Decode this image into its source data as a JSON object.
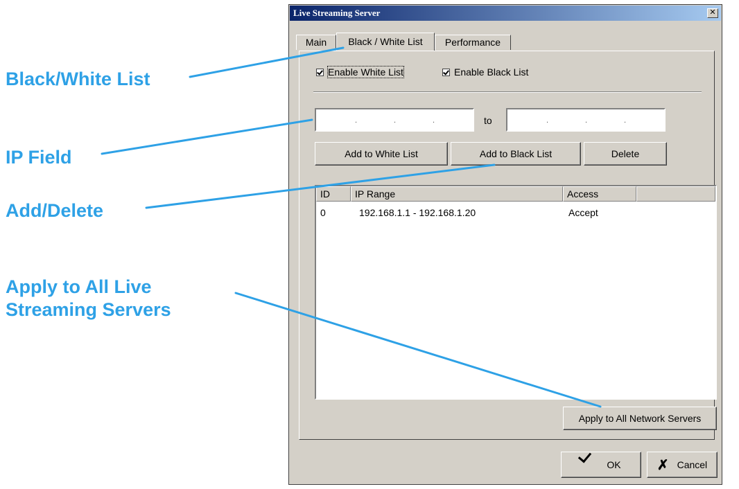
{
  "callouts": {
    "black_white_list": "Black/White List",
    "ip_field": "IP Field",
    "add_delete": "Add/Delete",
    "apply_line1": "Apply to All Live",
    "apply_line2": "Streaming Servers",
    "color": "#2ea1e6"
  },
  "dialog": {
    "title": "Live Streaming Server",
    "close_glyph": "✕",
    "tabs": [
      "Main",
      "Black / White List",
      "Performance"
    ],
    "active_tab": "Black / White List"
  },
  "lists": {
    "enable_white": {
      "label": "Enable White List",
      "checked": true
    },
    "enable_black": {
      "label": "Enable Black List",
      "checked": true
    }
  },
  "ip_range": {
    "to_label": "to",
    "separator": "."
  },
  "buttons": {
    "add_white": "Add to White List",
    "add_black": "Add to Black List",
    "delete": "Delete",
    "apply_all": "Apply to All Network Servers",
    "ok": "OK",
    "cancel": "Cancel"
  },
  "table": {
    "columns": [
      "ID",
      "IP Range",
      "Access"
    ],
    "rows": [
      {
        "id": "0",
        "ip_range": "192.168.1.1 - 192.168.1.20",
        "access": "Accept"
      }
    ]
  }
}
